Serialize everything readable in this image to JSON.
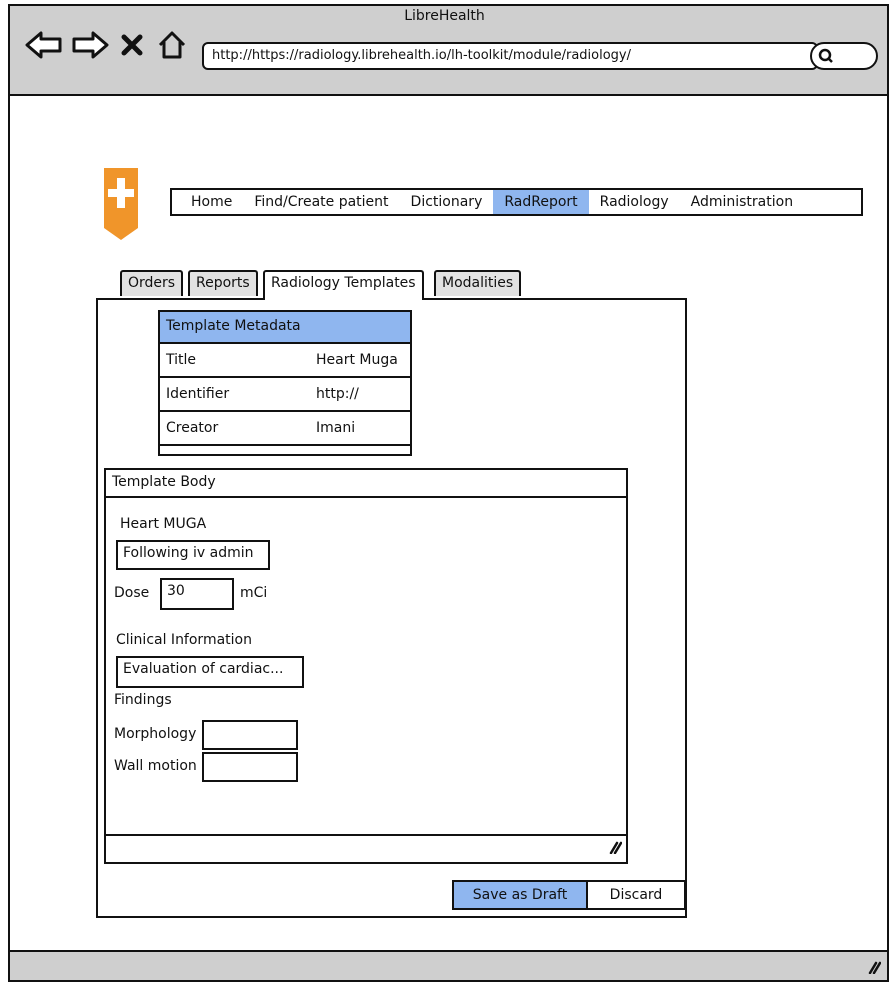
{
  "window": {
    "title": "LibreHealth"
  },
  "browser": {
    "url": "http://https://radiology.librehealth.io/lh-toolkit/module/radiology/",
    "icons": [
      "back-arrow-icon",
      "forward-arrow-icon",
      "close-x-icon",
      "home-icon",
      "search-icon",
      "resize-grip-icon"
    ]
  },
  "nav": {
    "items": [
      {
        "label": "Home"
      },
      {
        "label": "Find/Create patient"
      },
      {
        "label": "Dictionary"
      },
      {
        "label": "RadReport",
        "active": true
      },
      {
        "label": "Radiology"
      },
      {
        "label": "Administration"
      }
    ]
  },
  "tabs": [
    {
      "label": "Orders"
    },
    {
      "label": "Reports"
    },
    {
      "label": "Radiology Templates",
      "active": true
    },
    {
      "label": "Modalities"
    }
  ],
  "metadata": {
    "header": "Template Metadata",
    "rows": [
      {
        "key": "Title",
        "value": "Heart Muga"
      },
      {
        "key": "Identifier",
        "value": "http://"
      },
      {
        "key": "Creator",
        "value": "Imani"
      }
    ]
  },
  "template_body": {
    "header": "Template Body",
    "heading": "Heart MUGA",
    "admin_field": "Following iv admin",
    "dose_label": "Dose",
    "dose_value": "30",
    "dose_unit": "mCi",
    "clinical_label": "Clinical Information",
    "clinical_field": "Evaluation of cardiac...",
    "findings_label": "Findings",
    "morphology_label": "Morphology",
    "morphology_value": "",
    "wall_motion_label": "Wall motion",
    "wall_motion_value": ""
  },
  "actions": {
    "save_draft": "Save as Draft",
    "discard": "Discard"
  },
  "colors": {
    "accent": "#8fb6ef",
    "chrome": "#cfcfcf",
    "logo": "#f0952a"
  }
}
